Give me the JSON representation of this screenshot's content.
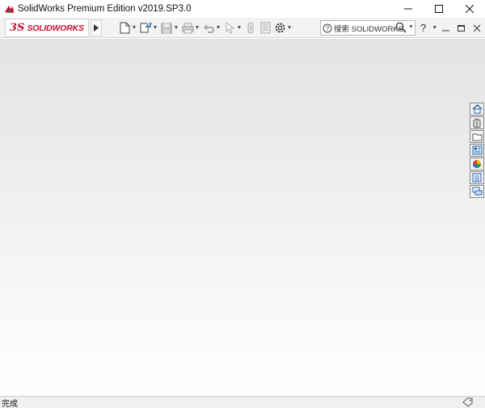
{
  "window": {
    "title": "SolidWorks Premium Edition v2019.SP3.0",
    "controls": {
      "minimize": "—",
      "maximize": "☐",
      "close": "✕"
    }
  },
  "toolbar": {
    "logo_ds": "3S",
    "logo_text": "SOLIDWORKS",
    "tools": [
      {
        "name": "new-document-icon",
        "dropdown": true
      },
      {
        "name": "open-document-icon",
        "dropdown": true
      },
      {
        "name": "save-icon",
        "dropdown": true
      },
      {
        "name": "print-icon",
        "dropdown": true
      },
      {
        "name": "undo-icon",
        "dropdown": true
      },
      {
        "name": "select-icon",
        "dropdown": true
      },
      {
        "name": "rebuild-icon",
        "dropdown": false
      },
      {
        "name": "file-properties-icon",
        "dropdown": false
      },
      {
        "name": "options-icon",
        "dropdown": true
      }
    ],
    "search": {
      "label": "搜索 SOLIDWORKS"
    },
    "help": {
      "label": "?"
    }
  },
  "taskpane": {
    "items": [
      "home-icon",
      "design-library-icon",
      "file-explorer-icon",
      "view-palette-icon",
      "appearances-icon",
      "custom-properties-icon",
      "forum-icon"
    ]
  },
  "statusbar": {
    "text": "完成"
  },
  "colors": {
    "brand": "#c8102e",
    "titlebar": "#ffffff",
    "toolbar": "#f3f3f3",
    "status": "#f0f0f0"
  }
}
